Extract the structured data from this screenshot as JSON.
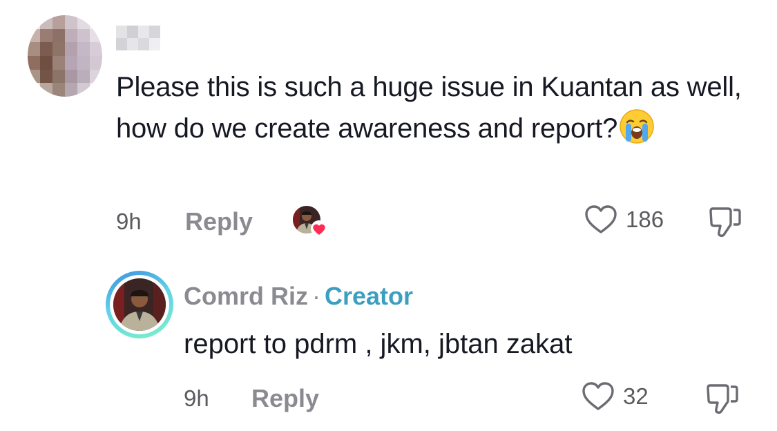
{
  "comment": {
    "username": "",
    "text": "Please this is such a huge issue in Kuantan as well, how do we create awareness and report?",
    "emoji": "loudly-crying-face",
    "time": "9h",
    "reply_label": "Reply",
    "like_count": "186",
    "liked_by_creator": true
  },
  "reply": {
    "username": "Comrd Riz",
    "separator": "·",
    "badge": "Creator",
    "text": "report to pdrm , jkm, jbtan zakat",
    "time": "9h",
    "reply_label": "Reply",
    "like_count": "32"
  },
  "colors": {
    "text_primary": "#161823",
    "text_secondary": "#8a8b91",
    "creator_badge": "#3c9ec0",
    "heart_badge": "#fe2c55"
  },
  "icons": {
    "like": "heart-outline-icon",
    "dislike": "thumbs-down-icon",
    "creator_like": "heart-badge-icon"
  }
}
